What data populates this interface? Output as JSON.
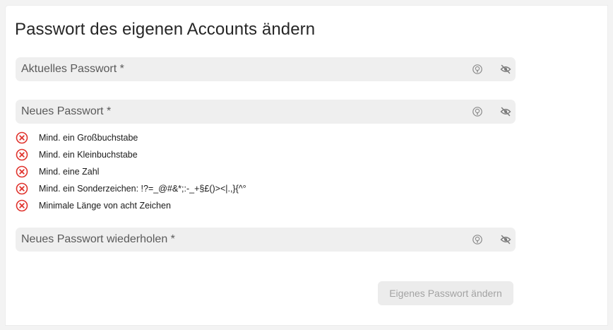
{
  "page": {
    "title": "Passwort des eigenen Accounts ändern"
  },
  "fields": {
    "current_password": {
      "placeholder": "Aktuelles Passwort *",
      "value": ""
    },
    "new_password": {
      "placeholder": "Neues Passwort *",
      "value": ""
    },
    "repeat_password": {
      "placeholder": "Neues Passwort wiederholen *",
      "value": ""
    }
  },
  "icons": {
    "generate": "password-generator-icon",
    "visibility": "eye-off-icon",
    "rule_status": "x-circle-icon"
  },
  "requirements": [
    {
      "label": "Mind. ein Großbuchstabe",
      "met": false
    },
    {
      "label": "Mind. ein Kleinbuchstabe",
      "met": false
    },
    {
      "label": "Mind. eine Zahl",
      "met": false
    },
    {
      "label": "Mind. ein Sonderzeichen: !?=_@#&*;:-_+§£()><|.,}{^°",
      "met": false
    },
    {
      "label": "Minimale Länge von acht Zeichen",
      "met": false
    }
  ],
  "actions": {
    "submit_label": "Eigenes Passwort ändern",
    "submit_enabled": false
  },
  "colors": {
    "error_red": "#e0332d",
    "field_bg": "#efefef",
    "icon_gray": "#8a8a8a",
    "button_disabled_bg": "#ececec",
    "button_disabled_text": "#a3a3a3"
  }
}
